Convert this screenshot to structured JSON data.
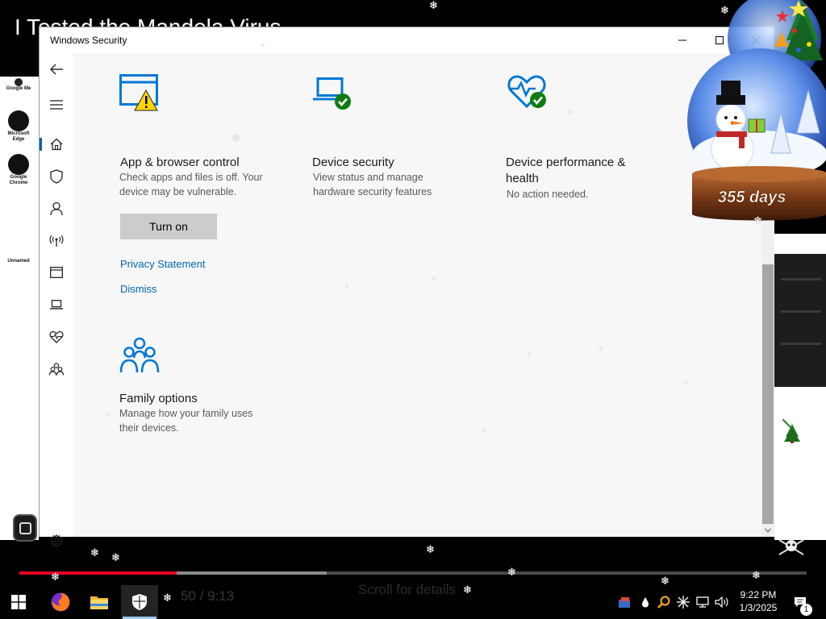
{
  "background_video": {
    "title": "I Tested the Mandela Virus",
    "time": "50 / 9:13",
    "scroll_hint": "Scroll for details",
    "progress_played": 0.2,
    "progress_buffered": 0.39
  },
  "desktop_icons": [
    {
      "label": "Google Me",
      "icon": "app-icon"
    },
    {
      "label": "Microsoft Edge",
      "icon": "edge-icon"
    },
    {
      "label": "Google Chrome",
      "icon": "chrome-icon"
    },
    {
      "label": "Unnamed",
      "icon": "app-icon"
    }
  ],
  "window": {
    "title": "Windows Security",
    "controls": [
      "minimize",
      "maximize",
      "close"
    ]
  },
  "sidebar": {
    "items": [
      {
        "icon": "back-arrow-icon"
      },
      {
        "icon": "hamburger-menu-icon"
      },
      {
        "icon": "home-icon",
        "selected": true
      },
      {
        "icon": "shield-icon"
      },
      {
        "icon": "person-icon"
      },
      {
        "icon": "wifi-antenna-icon"
      },
      {
        "icon": "app-browser-icon"
      },
      {
        "icon": "laptop-icon"
      },
      {
        "icon": "heart-pulse-icon"
      },
      {
        "icon": "family-icon"
      }
    ],
    "settings_icon": "gear-icon"
  },
  "cards": {
    "app_browser": {
      "title": "App & browser control",
      "description_line1": "Check apps and files is off.  Your",
      "description_line2": "device may be vulnerable.",
      "button": "Turn on",
      "privacy_link": "Privacy Statement",
      "dismiss_link": "Dismiss",
      "status_icon": "warning-icon"
    },
    "device_security": {
      "title": "Device security",
      "description_line1": "View status and manage",
      "description_line2": "hardware security features",
      "status_icon": "checkmark-icon"
    },
    "device_performance": {
      "title_line1": "Device performance &",
      "title_line2": "health",
      "description": "No action needed.",
      "status_icon": "checkmark-icon"
    },
    "family_options": {
      "title": "Family options",
      "description_line1": "Manage how your family uses",
      "description_line2": "their devices."
    }
  },
  "snow_globe": {
    "days_label": "355 days"
  },
  "taskbar": {
    "apps": [
      {
        "name": "start-button"
      },
      {
        "name": "firefox"
      },
      {
        "name": "file-explorer"
      },
      {
        "name": "windows-security",
        "active": true
      }
    ],
    "clock": {
      "time": "9:22 PM",
      "date": "1/3/2025"
    },
    "notification_count": "1"
  },
  "colors": {
    "accent": "#0078d4",
    "link": "#0066b4",
    "ok_green": "#107c10",
    "warn_yellow": "#ffd400",
    "progress_red": "#e60023"
  }
}
